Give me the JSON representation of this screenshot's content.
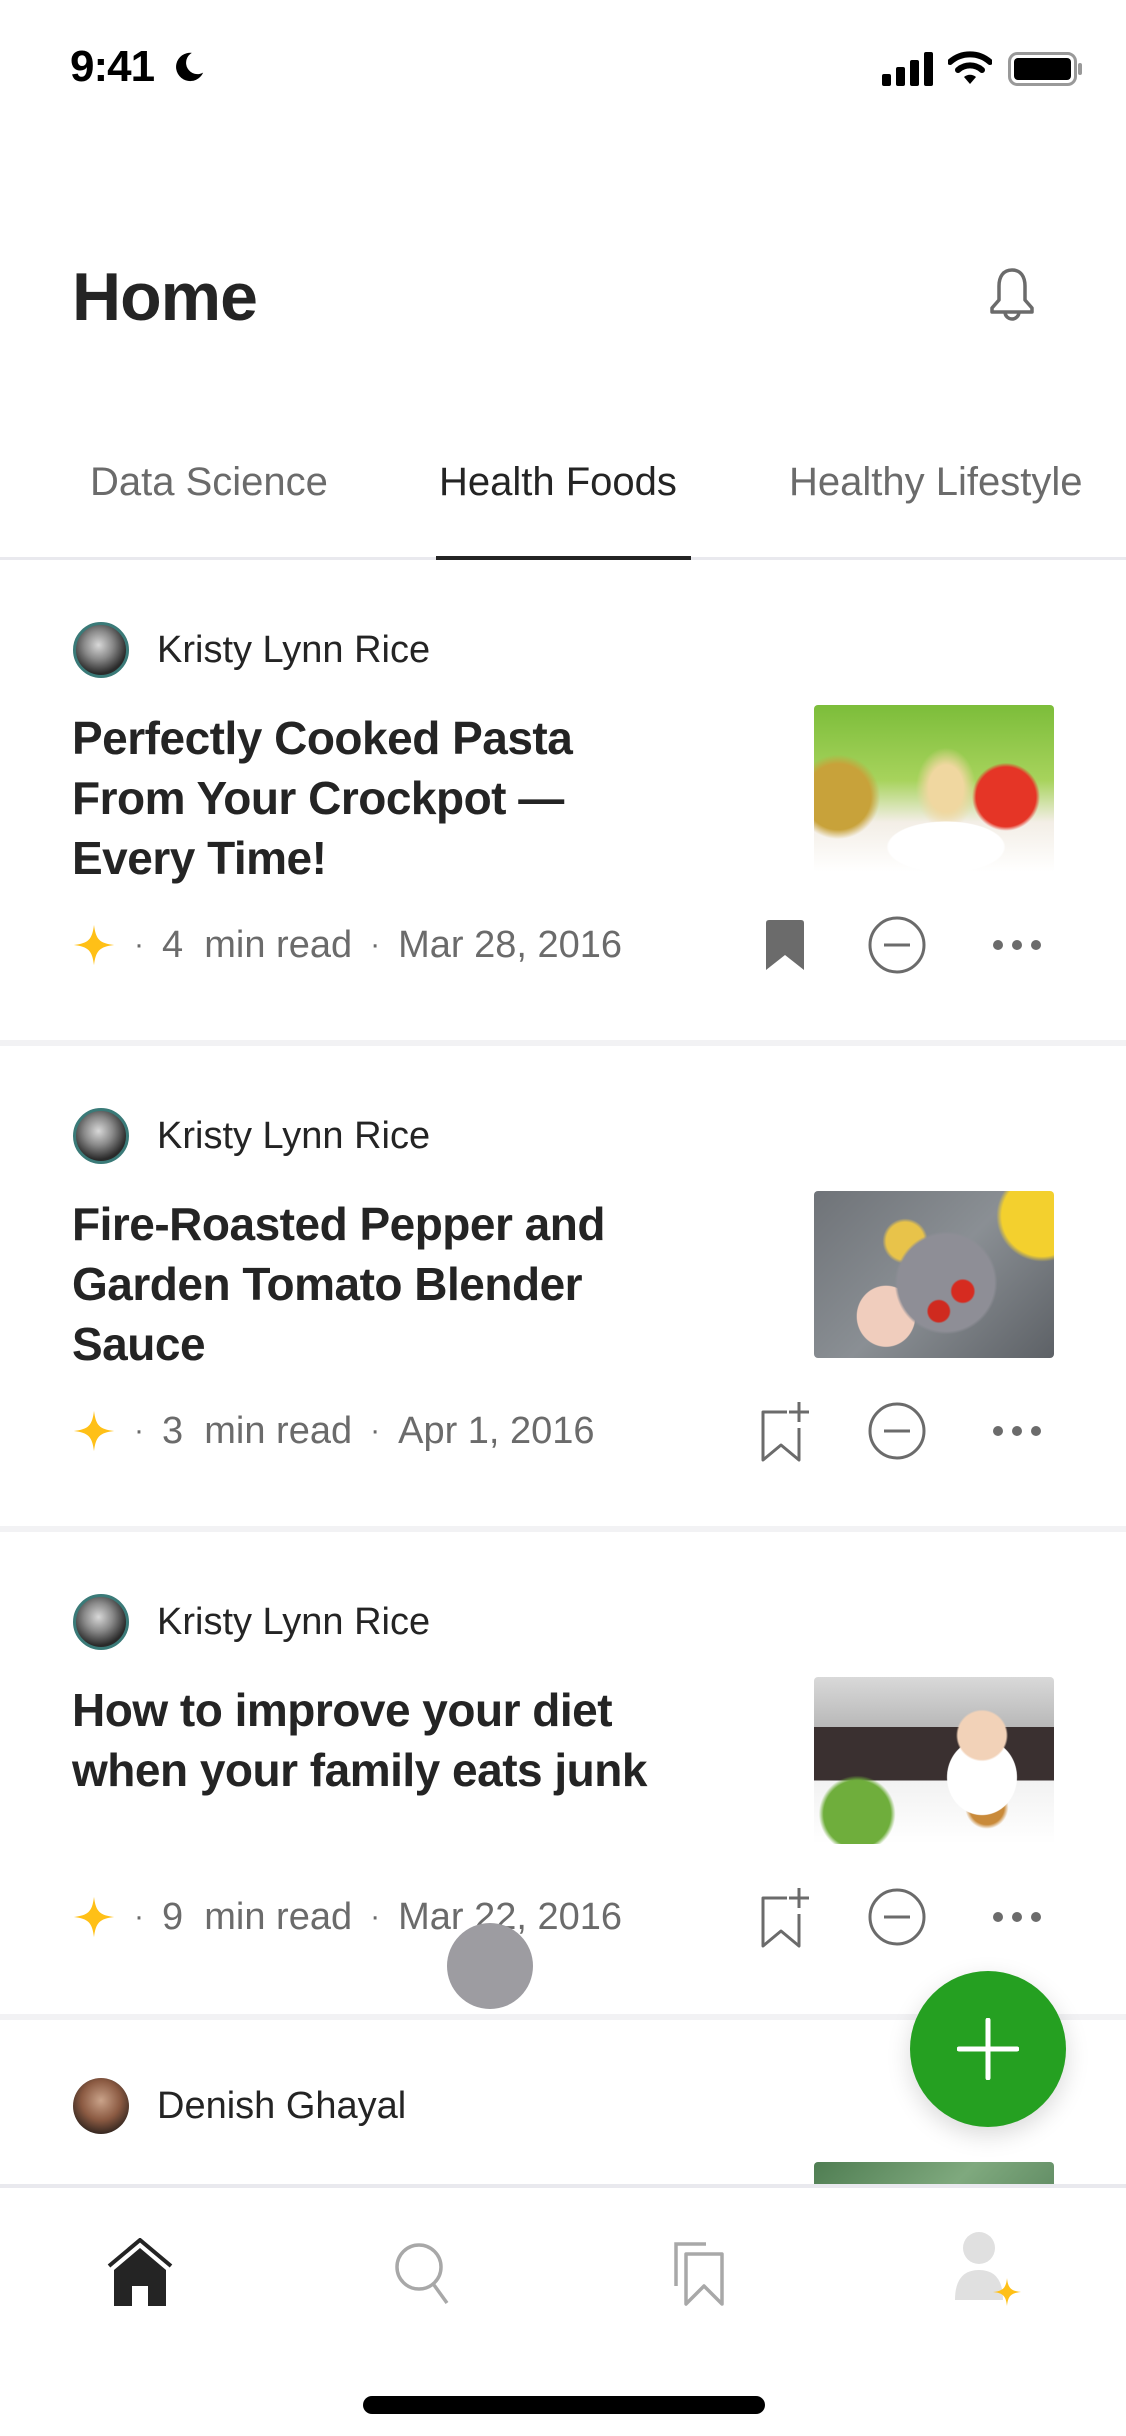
{
  "status_bar": {
    "time": "9:41",
    "focus_icon": "moon-icon",
    "signal_icon": "cellular-signal-icon",
    "wifi_icon": "wifi-icon",
    "battery_icon": "battery-full-icon"
  },
  "header": {
    "title": "Home",
    "notifications_icon": "bell-icon"
  },
  "tabs": [
    {
      "label": "Data Science",
      "active": false
    },
    {
      "label": "Health Foods",
      "active": true
    },
    {
      "label": "Healthy Lifestyle",
      "active": false
    }
  ],
  "articles": [
    {
      "author": "Kristy Lynn Rice",
      "title": "Perfectly Cooked Pasta From Your Crockpot — Every Time!",
      "member_only_icon": "star-icon",
      "read_time": "4  min read",
      "date": "Mar 28, 2016",
      "saved": true,
      "thumbnail": "pasta-photo"
    },
    {
      "author": "Kristy Lynn Rice",
      "title": "Fire-Roasted Pepper and Garden Tomato Blender Sauce",
      "member_only_icon": "star-icon",
      "read_time": "3  min read",
      "date": "Apr 1, 2016",
      "saved": false,
      "thumbnail": "blender-tomatoes-photo"
    },
    {
      "author": "Kristy Lynn Rice",
      "title": "How to improve your diet when your family eats junk",
      "member_only_icon": "star-icon",
      "read_time": "9  min read",
      "date": "Mar 22, 2016",
      "saved": false,
      "thumbnail": "child-salad-burger-photo"
    },
    {
      "author": "Denish Ghayal",
      "thumbnail": "greens-photo"
    }
  ],
  "separator": "·",
  "fab": {
    "icon": "plus-icon",
    "color": "#25a021"
  },
  "bottom_nav": [
    {
      "name": "home",
      "icon": "home-icon",
      "active": true
    },
    {
      "name": "search",
      "icon": "search-icon",
      "active": false
    },
    {
      "name": "library",
      "icon": "bookmarks-icon",
      "active": false
    },
    {
      "name": "profile",
      "icon": "profile-icon",
      "active": false
    }
  ],
  "colors": {
    "text_primary": "#242424",
    "text_secondary": "#6b6b6b",
    "accent_star": "#ffc017",
    "fab_green": "#25a021",
    "divider": "#f2f2f4"
  }
}
